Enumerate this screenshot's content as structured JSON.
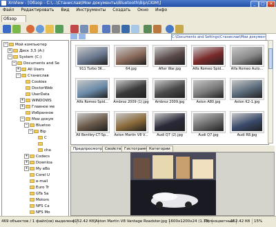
{
  "window": {
    "title": "XnView - [Обзор - C:\\...\\Станислав\\Мои документы\\Bluetooth\\Bip\\CKIM\\]"
  },
  "menu": [
    "Файл",
    "Редактировать",
    "Вид",
    "Инструменты",
    "Создать",
    "Окно",
    "Инфо"
  ],
  "left_tab": "Обзор",
  "address": "C:\\Documents and Settings\\Станислав\\Мои документы\\Bluetooth\\Bip\\CKIM\\",
  "tree": [
    {
      "label": "Мой компьютер",
      "indent": 0,
      "expander": "−"
    },
    {
      "label": "Диск 3,5 (A:)",
      "indent": 1,
      "expander": "+"
    },
    {
      "label": "System (C:)",
      "indent": 1,
      "expander": "−"
    },
    {
      "label": "Documents and Se",
      "indent": 2,
      "expander": "−"
    },
    {
      "label": "All Users",
      "indent": 3,
      "expander": "+"
    },
    {
      "label": "Станислав",
      "indent": 3,
      "expander": "−"
    },
    {
      "label": "Cookies",
      "indent": 4,
      "expander": ""
    },
    {
      "label": "DoctorWeb",
      "indent": 4,
      "expander": ""
    },
    {
      "label": "UserData",
      "indent": 4,
      "expander": ""
    },
    {
      "label": "WINDOWS",
      "indent": 4,
      "expander": "+"
    },
    {
      "label": "Главное ме",
      "indent": 4,
      "expander": "+"
    },
    {
      "label": "Избранное",
      "indent": 4,
      "expander": ""
    },
    {
      "label": "Мои докум",
      "indent": 4,
      "expander": "−"
    },
    {
      "label": "Bluetoo",
      "indent": 5,
      "expander": "−"
    },
    {
      "label": "Bip",
      "indent": 6,
      "expander": "−"
    },
    {
      "label": "C",
      "indent": 7,
      "expander": ""
    },
    {
      "label": "",
      "indent": 7,
      "expander": ""
    },
    {
      "label": "cha",
      "indent": 7,
      "expander": ""
    },
    {
      "label": "Codecs",
      "indent": 5,
      "expander": "+"
    },
    {
      "label": "Downloa",
      "indent": 5,
      "expander": "+"
    },
    {
      "label": "My eBo",
      "indent": 5,
      "expander": "+"
    },
    {
      "label": "Corel U",
      "indent": 5,
      "expander": ""
    },
    {
      "label": "e-mail",
      "indent": 5,
      "expander": ""
    },
    {
      "label": "Euro Tr",
      "indent": 5,
      "expander": ""
    },
    {
      "label": "GTa Sa",
      "indent": 5,
      "expander": ""
    },
    {
      "label": "Motorn",
      "indent": 5,
      "expander": ""
    },
    {
      "label": "NFS Ca",
      "indent": 5,
      "expander": ""
    },
    {
      "label": "NFS Mo",
      "indent": 5,
      "expander": ""
    }
  ],
  "thumbnails": [
    {
      "label": "911 Turbo 3K...",
      "color": "#6a7890"
    },
    {
      "label": "64.jpg",
      "color": "#8a6a5a"
    },
    {
      "label": "After War.jpg",
      "color": "#5a4a4a"
    },
    {
      "label": "Alfa Romeo Spid...",
      "color": "#7a2a2a"
    },
    {
      "label": "Alfa Romeo Auto...",
      "color": "#8a8a8a"
    },
    {
      "label": "Alfa Romeo Spid...",
      "color": "#6a8aa8"
    },
    {
      "label": "Ambroz 2009 (1).jpg",
      "color": "#3a3a3a"
    },
    {
      "label": "Ambroz 2009.jpg",
      "color": "#4a4a4a"
    },
    {
      "label": "Aston A80.jpg",
      "color": "#7a7a7a"
    },
    {
      "label": "Aston K2-1.jpg",
      "color": "#5a6a7a"
    },
    {
      "label": "All Bentley-CT-Sp...",
      "color": "#6a5a4a"
    },
    {
      "label": "Aston Martin V8 V...",
      "color": "#8a6a3a"
    },
    {
      "label": "Audi Q7 (2).jpg",
      "color": "#2a2a3a"
    },
    {
      "label": "Audi Q7.jpg",
      "color": "#6a6a6a"
    },
    {
      "label": "Audi R8.jpg",
      "color": "#3a4a6a"
    }
  ],
  "preview_tabs": [
    "Предпросмотр",
    "Свойства",
    "Гистограмма",
    "Категории"
  ],
  "status": {
    "count": "469 объектов / 1 файл(ов) выделено",
    "size": "[152.42 Кб]",
    "file": "Aston Martin V8 Vantage Roadster.jpg",
    "dims": "1600x1200x24 (1.33)",
    "color": "Полноцветный",
    "kb": "152.42 Кб",
    "zoom": "15%"
  }
}
